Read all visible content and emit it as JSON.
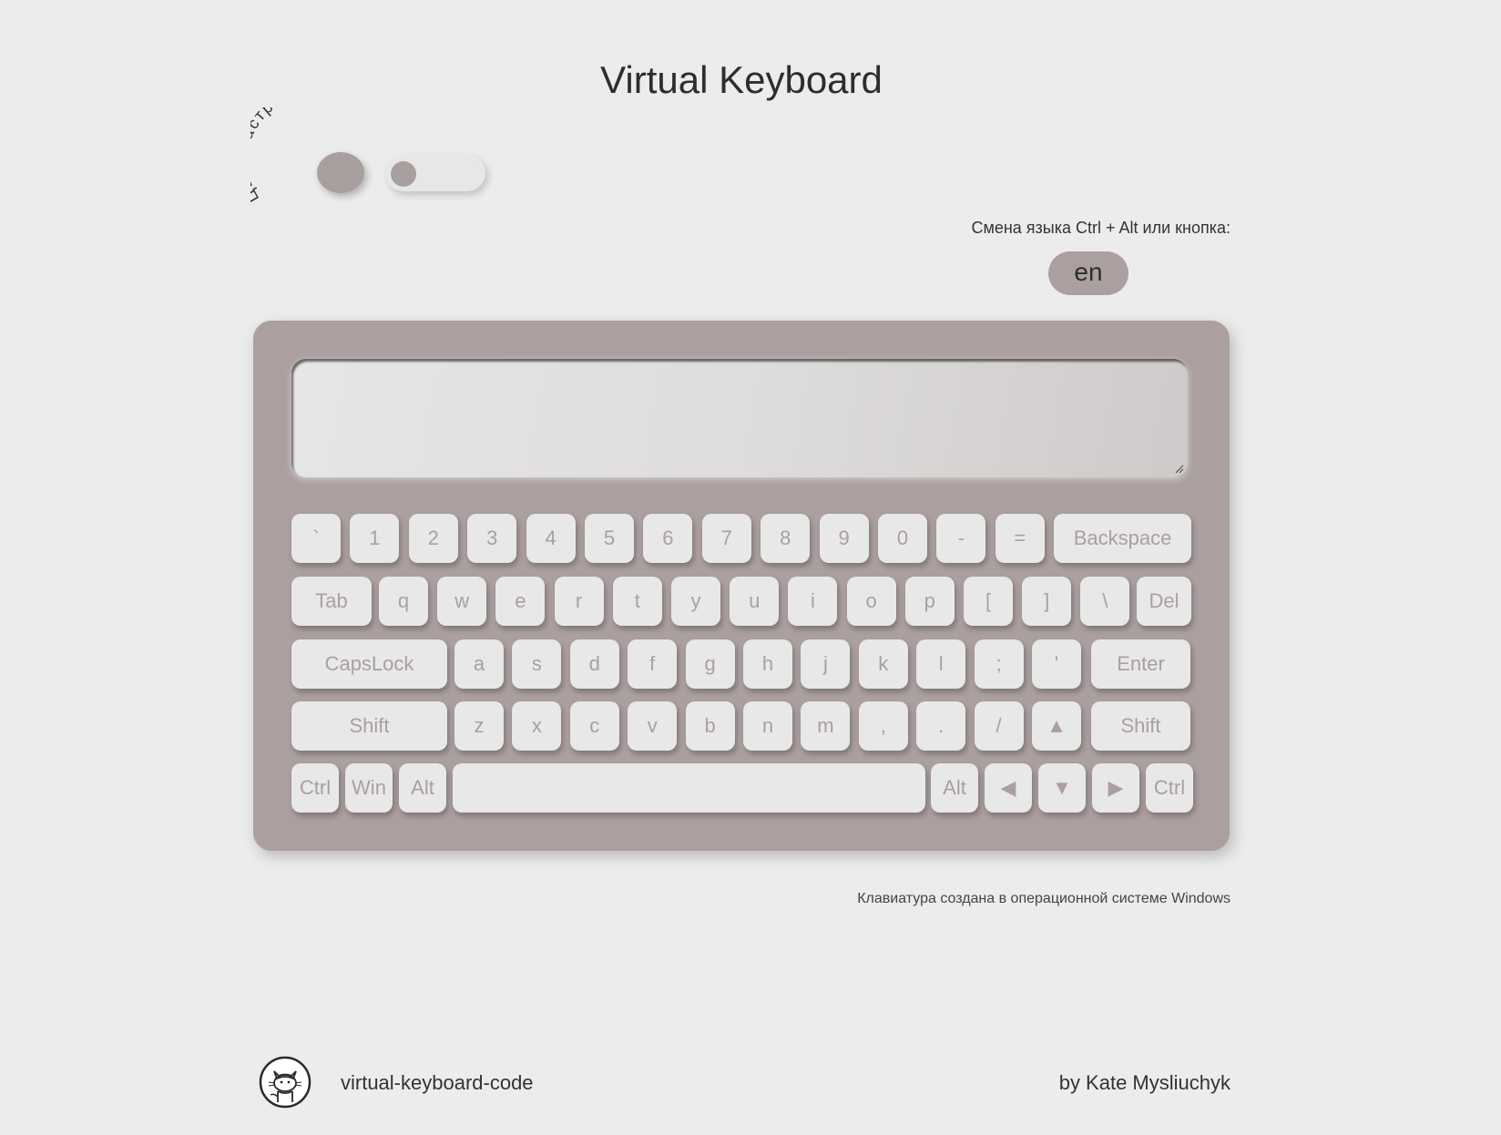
{
  "page": {
    "title": "Virtual Keyboard"
  },
  "mood": {
    "label": "Цвет настроения",
    "accent": "#a89f9f"
  },
  "language": {
    "hint": "Смена языка Ctrl + Alt или кнопка:",
    "current": "en"
  },
  "keyboard": {
    "case_color": "#ab9f9f",
    "key_color": "#e8e8e8",
    "label_color": "#ab9f9f",
    "rows": [
      [
        "`",
        "1",
        "2",
        "3",
        "4",
        "5",
        "6",
        "7",
        "8",
        "9",
        "0",
        "-",
        "=",
        "Backspace"
      ],
      [
        "Tab",
        "q",
        "w",
        "e",
        "r",
        "t",
        "y",
        "u",
        "i",
        "o",
        "p",
        "[",
        "]",
        "\\",
        "Del"
      ],
      [
        "CapsLock",
        "a",
        "s",
        "d",
        "f",
        "g",
        "h",
        "j",
        "k",
        "l",
        ";",
        "'",
        "Enter"
      ],
      [
        "Shift",
        "z",
        "x",
        "c",
        "v",
        "b",
        "n",
        "m",
        ",",
        ".",
        "/",
        "▲",
        "Shift"
      ],
      [
        "Ctrl",
        "Win",
        "Alt",
        "",
        "Alt",
        "◀",
        "▼",
        "▶",
        "Ctrl"
      ]
    ],
    "textarea_value": ""
  },
  "credit": "Клавиатура создана в операционной системе Windows",
  "footer": {
    "repo_link": "virtual-keyboard-code",
    "author": "by Kate Mysliuchyk",
    "icon": "github-icon"
  }
}
